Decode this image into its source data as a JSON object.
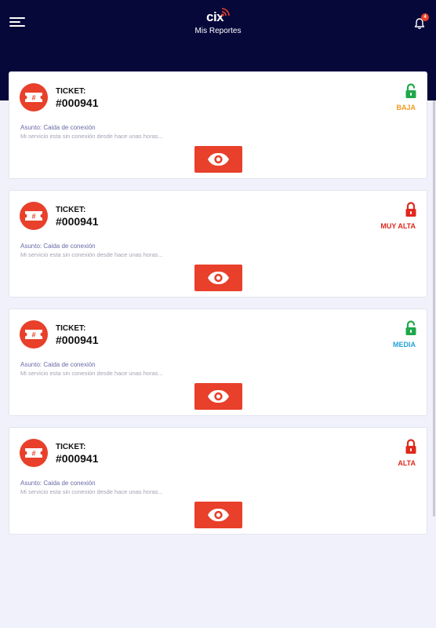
{
  "header": {
    "logo_text": "cix",
    "title": "Mis Reportes",
    "notification_count": "4",
    "background_color": "#07083a"
  },
  "icons": {
    "menu": "menu-icon",
    "bell": "bell-icon",
    "ticket": "ticket-icon",
    "view": "eye-icon",
    "lock_open": "lock-open-icon",
    "lock_closed": "lock-closed-icon"
  },
  "colors": {
    "accent": "#e8402a",
    "open_lock": "#1fa84a",
    "closed_lock": "#e0281c"
  },
  "tickets": [
    {
      "label": "TICKET:",
      "number": "#000941",
      "priority": "BAJA",
      "priority_color": "#f39a1e",
      "lock": "open",
      "subject": "Asunto: Caida de conexión",
      "description": "Mi servicio esta sin conexión desde hace unas horas..."
    },
    {
      "label": "TICKET:",
      "number": "#000941",
      "priority": "MUY ALTA",
      "priority_color": "#e0281c",
      "lock": "closed",
      "subject": "Asunto: Caida de conexión",
      "description": "Mi servicio esta sin conexión desde hace unas horas..."
    },
    {
      "label": "TICKET:",
      "number": "#000941",
      "priority": "MEDIA",
      "priority_color": "#25a3d8",
      "lock": "open",
      "subject": "Asunto: Caida de conexión",
      "description": "Mi servicio esta sin conexión desde hace unas horas..."
    },
    {
      "label": "TICKET:",
      "number": "#000941",
      "priority": "ALTA",
      "priority_color": "#e0281c",
      "lock": "closed",
      "subject": "Asunto: Caida de conexión",
      "description": "Mi servicio esta sin conexión desde hace unas horas..."
    }
  ]
}
